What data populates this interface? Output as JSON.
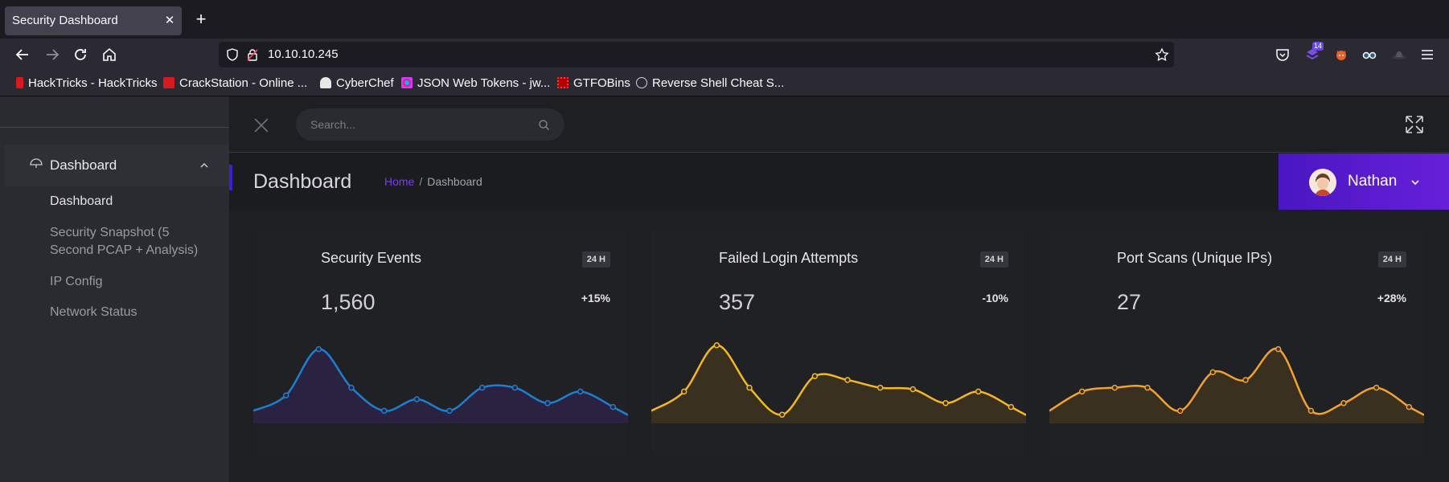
{
  "browser": {
    "tab_title": "Security Dashboard",
    "url": "10.10.10.245",
    "ext_badge": "14",
    "bookmarks": [
      {
        "label": "HackTricks - HackTricks",
        "color": "#d71921"
      },
      {
        "label": "CrackStation - Online ...",
        "color": "#d71921"
      },
      {
        "label": "CyberChef",
        "color": "#ffffff"
      },
      {
        "label": "JSON Web Tokens - jw...",
        "color": "#fb015b"
      },
      {
        "label": "GTFOBins",
        "color": "#b30000"
      },
      {
        "label": "Reverse Shell Cheat S...",
        "color": "#cfcfd8"
      }
    ]
  },
  "sidebar": {
    "group_label": "Dashboard",
    "items": [
      {
        "label": "Dashboard"
      },
      {
        "label": "Security Snapshot (5"
      },
      {
        "label": "Second PCAP + Analysis)"
      },
      {
        "label": "IP Config"
      },
      {
        "label": "Network Status"
      }
    ]
  },
  "topbar": {
    "search_placeholder": "Search..."
  },
  "page": {
    "title": "Dashboard",
    "breadcrumb_home": "Home",
    "breadcrumb_sep": "/",
    "breadcrumb_current": "Dashboard",
    "user_name": "Nathan"
  },
  "cards": [
    {
      "title": "Security Events",
      "badge": "24 H",
      "value": "1,560",
      "change": "+15%",
      "color": "#1e7fd0",
      "fill": "#2a2240"
    },
    {
      "title": "Failed Login Attempts",
      "badge": "24 H",
      "value": "357",
      "change": "-10%",
      "color": "#f4b825",
      "fill": "#3a3020"
    },
    {
      "title": "Port Scans (Unique IPs)",
      "badge": "24 H",
      "value": "27",
      "change": "+28%",
      "color": "#f2a233",
      "fill": "#3a3020"
    }
  ],
  "chart_data": [
    {
      "type": "area",
      "series": [
        {
          "values": [
            10,
            30,
            90,
            40,
            10,
            25,
            10,
            40,
            40,
            20,
            35,
            15
          ]
        }
      ]
    },
    {
      "type": "area",
      "series": [
        {
          "values": [
            10,
            35,
            95,
            40,
            5,
            55,
            50,
            40,
            38,
            20,
            35,
            15
          ]
        }
      ]
    },
    {
      "type": "area",
      "series": [
        {
          "values": [
            10,
            35,
            40,
            40,
            10,
            60,
            50,
            90,
            10,
            20,
            40,
            15
          ]
        }
      ]
    }
  ]
}
